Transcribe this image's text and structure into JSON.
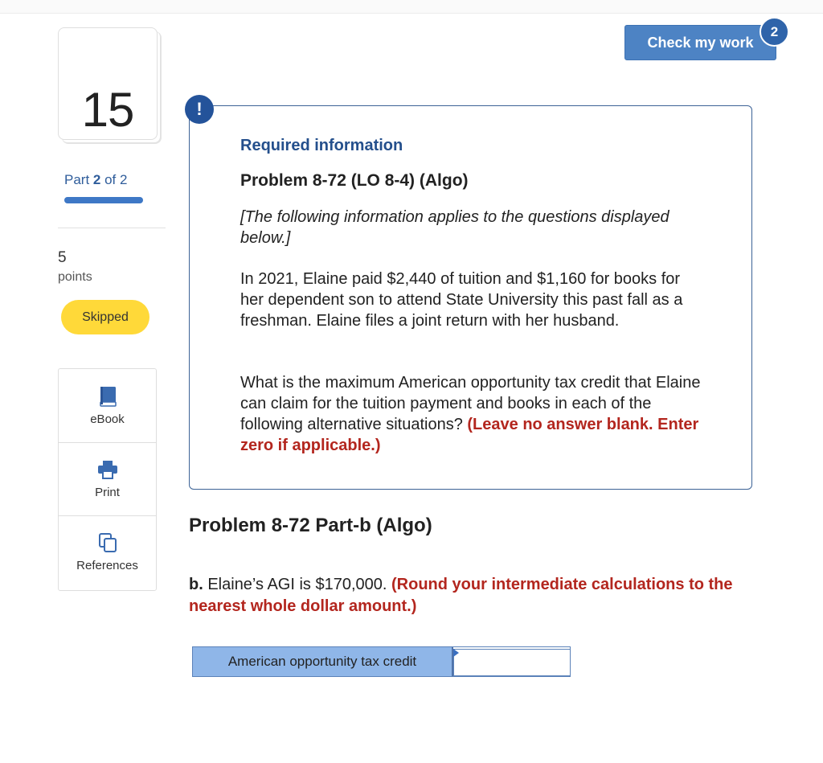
{
  "sidebar": {
    "question_number": "15",
    "part_prefix": "Part ",
    "part_current": "2",
    "part_suffix": " of 2",
    "progress_fraction": 1.0,
    "points_value": "5",
    "points_label": "points",
    "status": "Skipped",
    "tools": [
      {
        "label": "eBook",
        "icon": "book-icon"
      },
      {
        "label": "Print",
        "icon": "printer-icon"
      },
      {
        "label": "References",
        "icon": "references-icon"
      }
    ]
  },
  "header": {
    "check_button": "Check my work",
    "check_badge": "2"
  },
  "required_info": {
    "alert_symbol": "!",
    "title": "Required information",
    "problem_title": "Problem 8-72 (LO 8-4) (Algo)",
    "italic_note": "[The following information applies to the questions displayed below.]",
    "paragraph": "In 2021, Elaine paid $2,440 of tuition and $1,160 for books for her dependent son to attend State University this past fall as a freshman. Elaine files a joint return with her husband.",
    "question": "What is the maximum American opportunity tax credit that Elaine can claim for the tuition payment and books in each of the following alternative situations?",
    "question_instruction": "(Leave no answer blank. Enter zero if applicable.)"
  },
  "part_b": {
    "title": "Problem 8-72 Part-b (Algo)",
    "label_bold": "b.",
    "text": " Elaine’s AGI is $170,000. ",
    "instruction": "(Round your intermediate calculations to the nearest whole dollar amount.)",
    "answer_label": "American opportunity tax credit",
    "answer_value": ""
  },
  "colors": {
    "accent_blue": "#244f8c",
    "button_blue": "#4d83c4",
    "skipped_yellow": "#ffd939",
    "instruction_red": "#b3261e",
    "answer_label_bg": "#8fb6e8"
  }
}
